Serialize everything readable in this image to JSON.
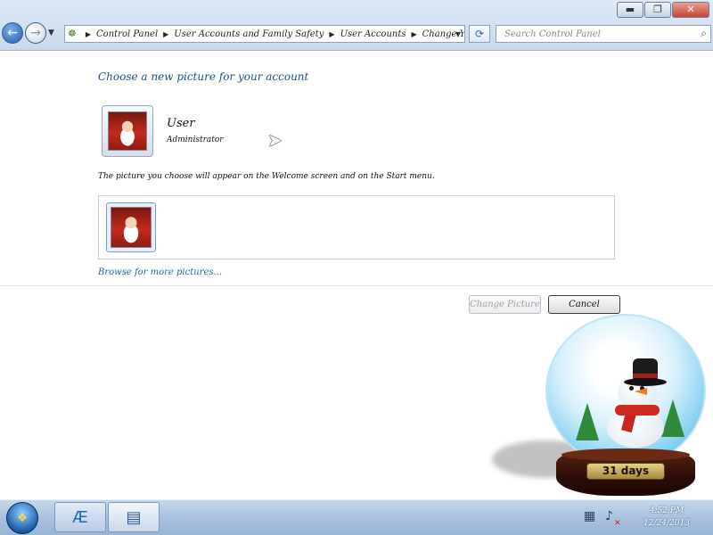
{
  "window": {
    "minimize_glyph": "▬",
    "maximize_glyph": "❐",
    "close_glyph": "✕"
  },
  "nav": {
    "back_glyph": "←",
    "forward_glyph": "→",
    "history_glyph": "▼"
  },
  "address": {
    "breadcrumbs": [
      "Control Panel",
      "User Accounts and Family Safety",
      "User Accounts",
      "Change Your Picture"
    ],
    "separator": "▶",
    "dropdown_glyph": "▼",
    "refresh_glyph": "⟳"
  },
  "search": {
    "placeholder": "Search Control Panel",
    "icon": "search-icon"
  },
  "content": {
    "title": "Choose a new picture for your account",
    "user_name": "User",
    "user_role": "Administrator",
    "description": "The picture you choose will appear on the Welcome screen and on the Start menu.",
    "browse_link": "Browse for more pictures..."
  },
  "buttons": {
    "change_picture": "Change Picture",
    "cancel": "Cancel"
  },
  "gadget": {
    "days_count": "31",
    "days_label": "days"
  },
  "taskbar": {
    "clock_time": "4:52 PM",
    "clock_date": "12/24/2013"
  },
  "colors": {
    "link": "#1d64b7",
    "title": "#1e4e8c",
    "taskbar": "#a9c2df"
  }
}
